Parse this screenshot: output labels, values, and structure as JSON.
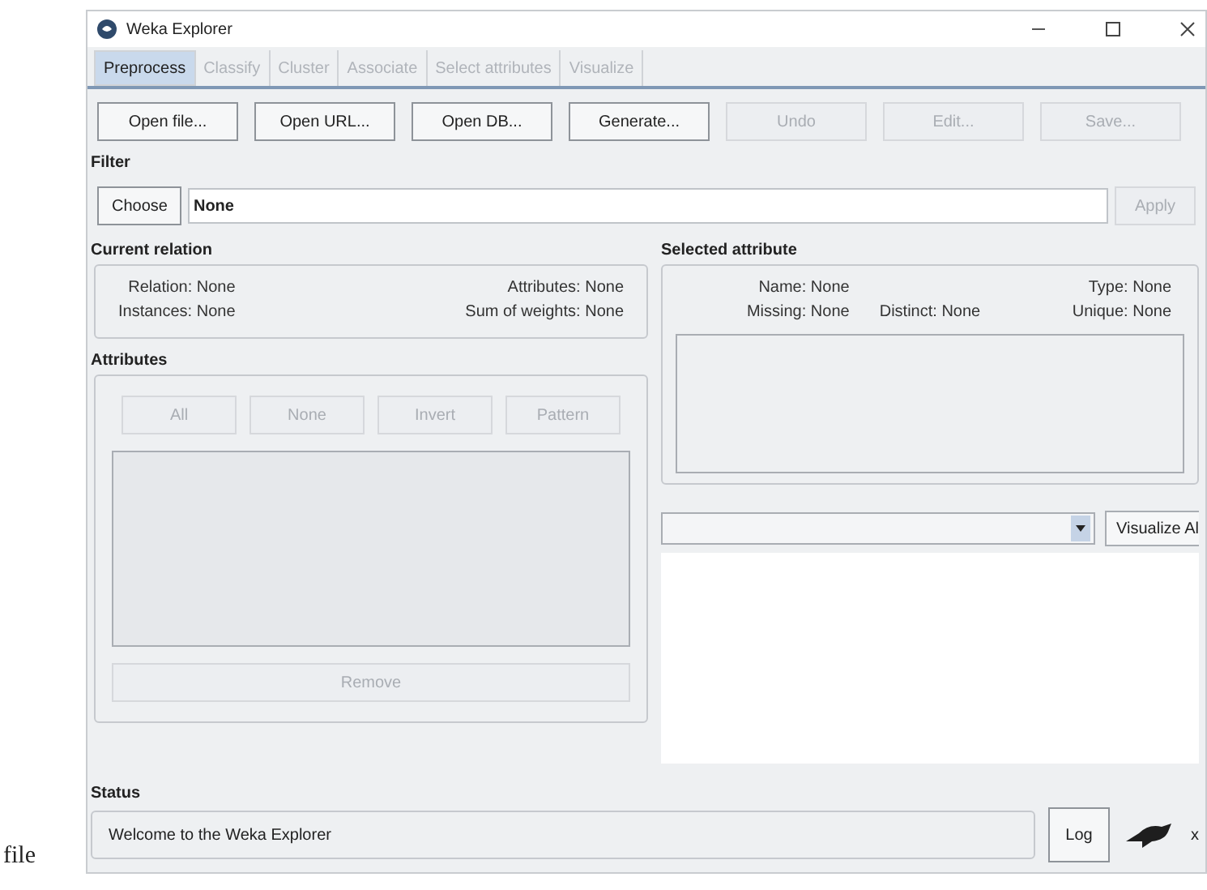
{
  "page_caption": "file",
  "window": {
    "title": "Weka Explorer"
  },
  "tabs": [
    {
      "label": "Preprocess",
      "selected": true,
      "disabled": false
    },
    {
      "label": "Classify",
      "selected": false,
      "disabled": true
    },
    {
      "label": "Cluster",
      "selected": false,
      "disabled": true
    },
    {
      "label": "Associate",
      "selected": false,
      "disabled": true
    },
    {
      "label": "Select attributes",
      "selected": false,
      "disabled": true
    },
    {
      "label": "Visualize",
      "selected": false,
      "disabled": true
    }
  ],
  "toolbar": [
    {
      "label": "Open file...",
      "disabled": false
    },
    {
      "label": "Open URL...",
      "disabled": false
    },
    {
      "label": "Open DB...",
      "disabled": false
    },
    {
      "label": "Generate...",
      "disabled": false
    },
    {
      "label": "Undo",
      "disabled": true
    },
    {
      "label": "Edit...",
      "disabled": true
    },
    {
      "label": "Save...",
      "disabled": true
    }
  ],
  "filter": {
    "heading": "Filter",
    "choose": "Choose",
    "value": "None",
    "apply": {
      "label": "Apply",
      "disabled": true
    }
  },
  "current_relation": {
    "heading": "Current relation",
    "left": [
      {
        "label": "Relation:",
        "value": "None"
      },
      {
        "label": "Instances:",
        "value": "None"
      }
    ],
    "right": [
      {
        "label": "Attributes:",
        "value": "None"
      },
      {
        "label": "Sum of weights:",
        "value": "None"
      }
    ]
  },
  "attributes": {
    "heading": "Attributes",
    "buttons": [
      {
        "label": "All",
        "disabled": true
      },
      {
        "label": "None",
        "disabled": true
      },
      {
        "label": "Invert",
        "disabled": true
      },
      {
        "label": "Pattern",
        "disabled": true
      }
    ],
    "remove": {
      "label": "Remove",
      "disabled": true
    }
  },
  "selected_attribute": {
    "heading": "Selected attribute",
    "name": {
      "label": "Name:",
      "value": "None"
    },
    "missing": {
      "label": "Missing:",
      "value": "None"
    },
    "distinct": {
      "label": "Distinct:",
      "value": "None"
    },
    "type": {
      "label": "Type:",
      "value": "None"
    },
    "unique": {
      "label": "Unique:",
      "value": "None"
    }
  },
  "visualize_button": "Visualize Al",
  "status": {
    "heading": "Status",
    "message": "Welcome to the Weka Explorer",
    "log": "Log",
    "count": "x"
  }
}
